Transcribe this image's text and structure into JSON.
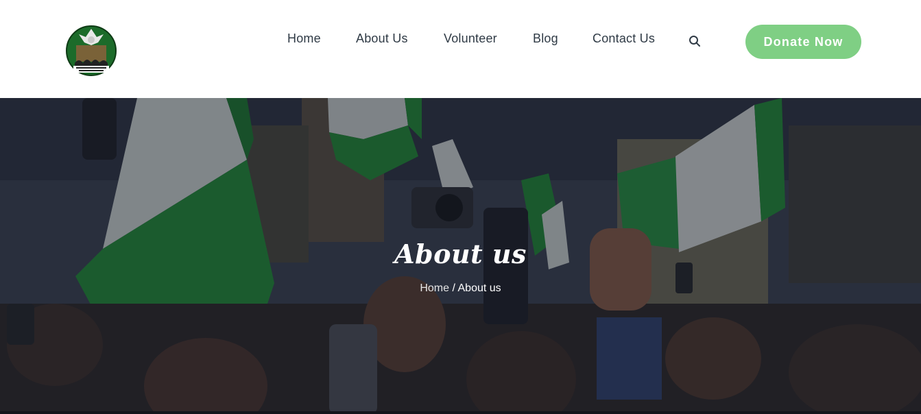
{
  "header": {
    "logo_icon": "phoenix-emblem-logo",
    "nav": [
      {
        "label": "Home"
      },
      {
        "label": "About Us"
      },
      {
        "label": "Volunteer"
      },
      {
        "label": "Blog"
      },
      {
        "label": "Contact Us"
      }
    ],
    "search_icon": "search-icon",
    "donate_label": "Donate Now"
  },
  "hero": {
    "title": "About us",
    "breadcrumb": {
      "home": "Home",
      "separator": "/",
      "current": "About us"
    }
  },
  "colors": {
    "accent": "#7fcf84",
    "nav_text": "#2f3a45",
    "flag_green": "#1e8a2e",
    "flag_white": "#e9ece8"
  }
}
